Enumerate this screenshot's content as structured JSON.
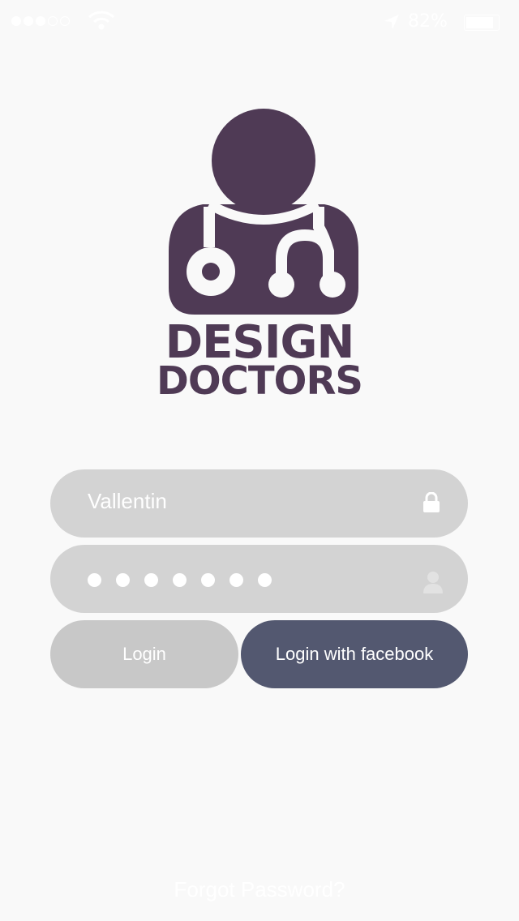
{
  "status_bar": {
    "signal_bars_filled": 3,
    "signal_bars_total": 5,
    "battery_percent": "82%",
    "battery_level": 0.82
  },
  "logo": {
    "line1": "DESIGN",
    "line2": "DOCTORS",
    "color": "#4f3a55"
  },
  "form": {
    "username_value": "Vallentin",
    "password_mask_count": 7,
    "login_label": "Login",
    "facebook_label": "Login with facebook",
    "forgot_label": "Forgot Password?"
  },
  "colors": {
    "field_bg": "#d3d3d3",
    "login_bg": "#c8c8c8",
    "facebook_bg": "#535870"
  }
}
